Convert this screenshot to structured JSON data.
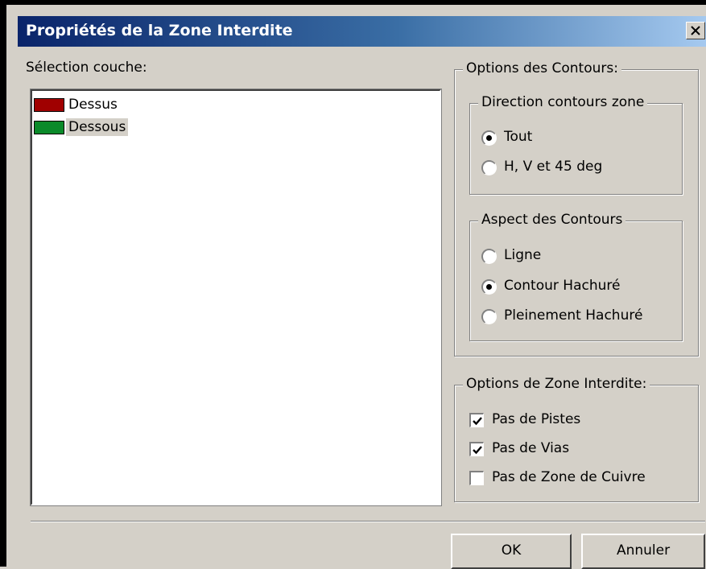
{
  "window": {
    "title": "Propriétés de la Zone Interdite",
    "close_glyph": "✕"
  },
  "layer_selection": {
    "label": "Sélection couche:",
    "items": [
      {
        "label": "Dessus",
        "color": "#a00000",
        "selected": false
      },
      {
        "label": "Dessous",
        "color": "#0a8a2a",
        "selected": true
      }
    ]
  },
  "outline_options": {
    "title": "Options des Contours:",
    "direction": {
      "title": "Direction contours zone",
      "options": [
        {
          "label": "Tout",
          "checked": true
        },
        {
          "label": "H, V et 45  deg",
          "checked": false
        }
      ]
    },
    "aspect": {
      "title": "Aspect des Contours",
      "options": [
        {
          "label": "Ligne",
          "checked": false
        },
        {
          "label": "Contour Hachuré",
          "checked": true
        },
        {
          "label": "Pleinement Hachuré",
          "checked": false
        }
      ]
    }
  },
  "keepout_options": {
    "title": "Options de Zone Interdite:",
    "options": [
      {
        "label": "Pas de Pistes",
        "checked": true
      },
      {
        "label": "Pas de Vias",
        "checked": true
      },
      {
        "label": "Pas de Zone de Cuivre",
        "checked": false
      }
    ]
  },
  "buttons": {
    "ok": "OK",
    "cancel": "Annuler"
  },
  "colors": {
    "title_gradient_start": "#0a246a",
    "title_gradient_end": "#a6caf0",
    "dialog_face": "#d4d0c8"
  }
}
